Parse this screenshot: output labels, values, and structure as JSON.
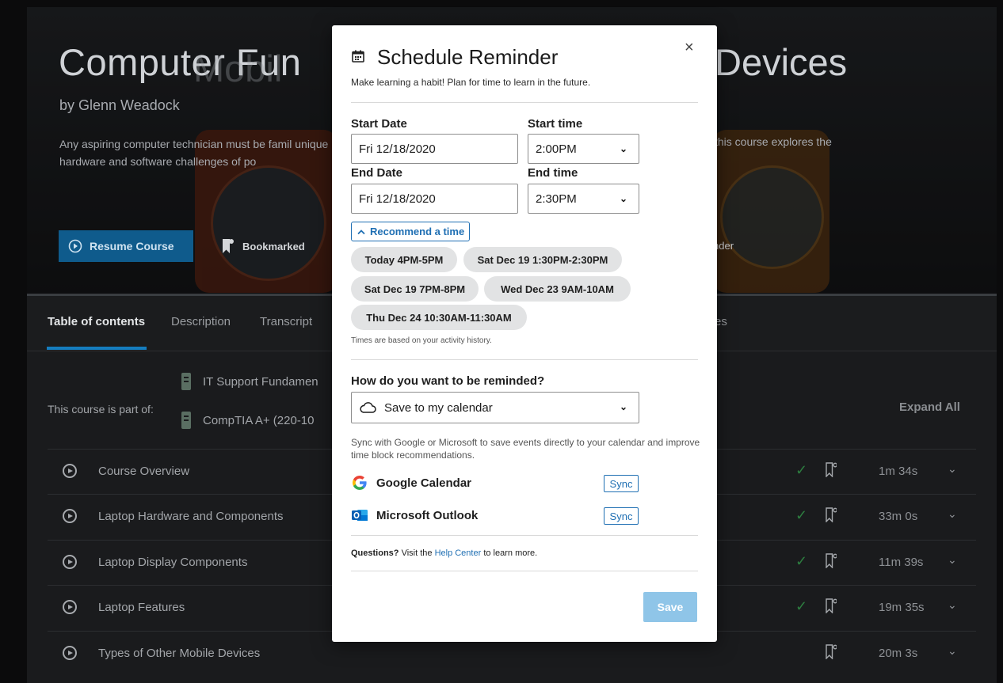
{
  "course": {
    "title": "Computer Fun",
    "title_ghost": "Mobil",
    "title_right": "Devices",
    "byline": "by Glenn Weadock",
    "description": "Any aspiring computer technician must be famil unique hardware and software challenges of po",
    "description_right": "this course explores the",
    "resume_label": "Resume Course",
    "bookmarked_label": "Bookmarked",
    "reminder_partial": "nder"
  },
  "tabs": [
    "Table of contents",
    "Description",
    "Transcript"
  ],
  "tab_partial": "es",
  "paths": {
    "label": "This course is part of:",
    "items": [
      "IT Support Fundamen",
      "CompTIA A+ (220-10"
    ],
    "expand_all": "Expand All"
  },
  "contents": [
    {
      "title": "Course Overview",
      "duration": "1m 34s",
      "completed": true
    },
    {
      "title": "Laptop Hardware and Components",
      "duration": "33m 0s",
      "completed": true
    },
    {
      "title": "Laptop Display Components",
      "duration": "11m 39s",
      "completed": true
    },
    {
      "title": "Laptop Features",
      "duration": "19m 35s",
      "completed": true
    },
    {
      "title": "Types of Other Mobile Devices",
      "duration": "20m 3s",
      "completed": false
    }
  ],
  "modal": {
    "title": "Schedule Reminder",
    "subtitle": "Make learning a habit! Plan for time to learn in the future.",
    "close": "×",
    "start_date_label": "Start Date",
    "start_date": "Fri 12/18/2020",
    "start_time_label": "Start time",
    "start_time": "2:00PM",
    "end_date_label": "End Date",
    "end_date": "Fri 12/18/2020",
    "end_time_label": "End time",
    "end_time": "2:30PM",
    "recommend_label": "Recommend a time",
    "recommendations": [
      "Today 4PM-5PM",
      "Sat Dec 19 1:30PM-2:30PM",
      "Sat Dec 19 7PM-8PM",
      "Wed Dec 23 9AM-10AM",
      "Thu Dec 24 10:30AM-11:30AM"
    ],
    "activity_note": "Times are based on your activity history.",
    "remind_question": "How do you want to be reminded?",
    "remind_method": "Save to my calendar",
    "sync_description": "Sync with Google or Microsoft to save events directly to your calendar and improve time block recommendations.",
    "providers": [
      {
        "name": "Google Calendar",
        "sync_label": "Sync"
      },
      {
        "name": "Microsoft Outlook",
        "sync_label": "Sync"
      }
    ],
    "questions_bold": "Questions?",
    "questions_pre": " Visit the ",
    "help_center": "Help Center",
    "questions_post": " to learn more.",
    "save_label": "Save"
  },
  "colors": {
    "accent": "#1f6fb3",
    "save_disabled": "#8fc5e8",
    "resume_bg": "#0f5b8c",
    "tab_underline": "#157dbf",
    "complete_check": "#2d7c3f"
  }
}
